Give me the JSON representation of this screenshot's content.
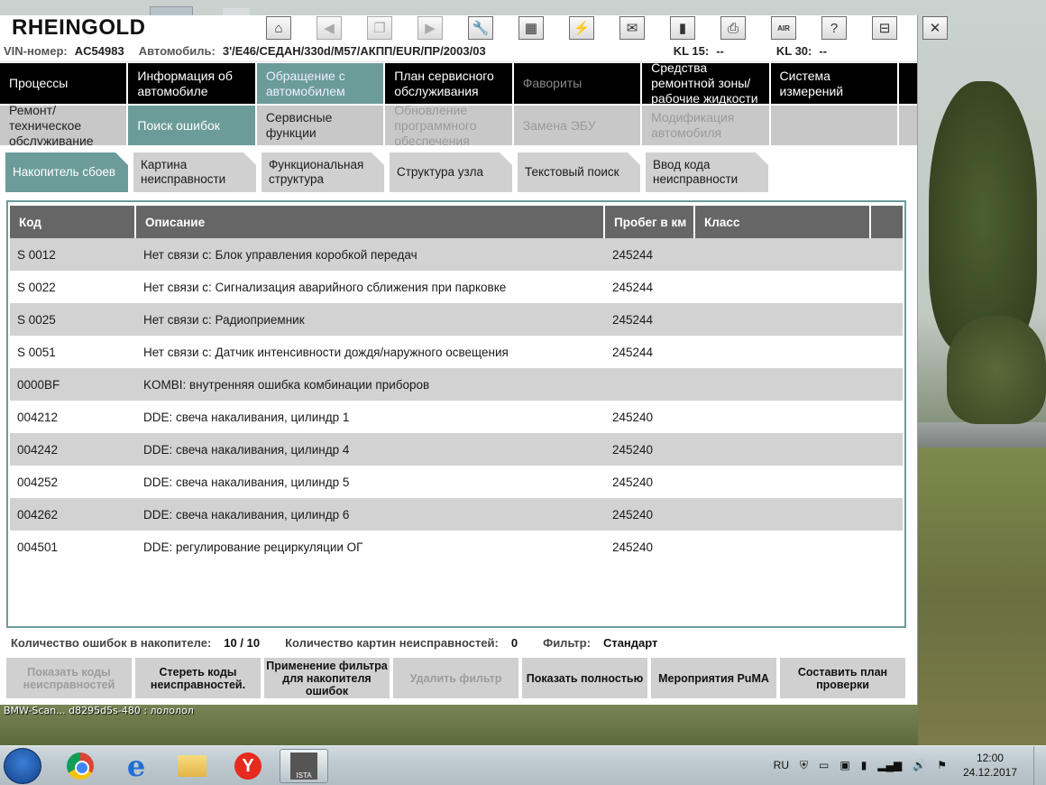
{
  "app": {
    "title": "RHEINGOLD"
  },
  "toolbar": {
    "icons": [
      "home-icon",
      "back-icon",
      "copy-icon",
      "forward-icon",
      "wrench-icon",
      "bmw-info-icon",
      "plug-icon",
      "mail-icon",
      "battery-icon",
      "printer-icon",
      "air-search-icon",
      "help-icon",
      "minimize-icon",
      "close-icon"
    ],
    "air_label": "AIR",
    "help_label": "?"
  },
  "vehicle": {
    "vin_label": "VIN-номер:",
    "vin": "AC54983",
    "car_label": "Автомобиль:",
    "car": "3'/E46/СЕДАН/330d/M57/АКПП/EUR/ПР/2003/03",
    "kl15_label": "KL 15:",
    "kl15": "--",
    "kl30_label": "KL 30:",
    "kl30": "--"
  },
  "main_nav": [
    {
      "label": "Процессы"
    },
    {
      "label": "Информация об автомобиле"
    },
    {
      "label": "Обращение с автомобилем"
    },
    {
      "label": "План сервисного обслуживания"
    },
    {
      "label": "Фавориты"
    },
    {
      "label": "Средства ремонтной зоны/ рабочие жидкости"
    },
    {
      "label": "Система измерений"
    }
  ],
  "sub_nav": [
    {
      "label": "Ремонт/ техническое обслуживание"
    },
    {
      "label": "Поиск ошибок"
    },
    {
      "label": "Сервисные функции"
    },
    {
      "label": "Обновление программного обеспечения"
    },
    {
      "label": "Замена ЭБУ"
    },
    {
      "label": "Модификация автомобиля"
    },
    {
      "label": ""
    }
  ],
  "tabs": [
    {
      "label": "Накопитель сбоев"
    },
    {
      "label": "Картина неисправности"
    },
    {
      "label": "Функциональная структура"
    },
    {
      "label": "Структура узла"
    },
    {
      "label": "Текстовый поиск"
    },
    {
      "label": "Ввод кода неисправности"
    }
  ],
  "table": {
    "headers": {
      "code": "Код",
      "desc": "Описание",
      "mileage": "Пробег в км",
      "class": "Класс"
    },
    "rows": [
      {
        "code": "S 0012",
        "desc": "Нет связи с: Блок управления коробкой передач",
        "mileage": "245244"
      },
      {
        "code": "S 0022",
        "desc": "Нет связи с: Сигнализация аварийного сближения при парковке",
        "mileage": "245244"
      },
      {
        "code": "S 0025",
        "desc": "Нет связи с: Радиоприемник",
        "mileage": "245244"
      },
      {
        "code": "S 0051",
        "desc": "Нет связи с: Датчик интенсивности дождя/наружного освещения",
        "mileage": "245244"
      },
      {
        "code": "0000BF",
        "desc": "KOMBI: внутренняя ошибка комбинации приборов",
        "mileage": ""
      },
      {
        "code": "004212",
        "desc": "DDE: свеча накаливания, цилиндр 1",
        "mileage": "245240"
      },
      {
        "code": "004242",
        "desc": "DDE: свеча накаливания, цилиндр 4",
        "mileage": "245240"
      },
      {
        "code": "004252",
        "desc": "DDE: свеча накаливания, цилиндр 5",
        "mileage": "245240"
      },
      {
        "code": "004262",
        "desc": "DDE: свеча накаливания, цилиндр 6",
        "mileage": "245240"
      },
      {
        "code": "004501",
        "desc": "DDE: регулирование рециркуляции ОГ",
        "mileage": "245240"
      }
    ]
  },
  "status": {
    "errors_label": "Количество ошибок в накопителе:",
    "errors": "10 / 10",
    "pictures_label": "Количество картин неисправностей:",
    "pictures": "0",
    "filter_label": "Фильтр:",
    "filter": "Стандарт"
  },
  "buttons": [
    {
      "label": "Показать коды неисправностей"
    },
    {
      "label": "Стереть коды неисправностей."
    },
    {
      "label": "Применение фильтра для накопителя ошибок"
    },
    {
      "label": "Удалить фильтр"
    },
    {
      "label": "Показать полностью"
    },
    {
      "label": "Мероприятия PuMA"
    },
    {
      "label": "Составить план проверки"
    }
  ],
  "desktop_info": "BMW-Scan... d8295d5s-480 : лололол",
  "taskbar": {
    "lang": "RU",
    "time": "12:00",
    "date": "24.12.2017",
    "ista_label": "ISTA"
  }
}
